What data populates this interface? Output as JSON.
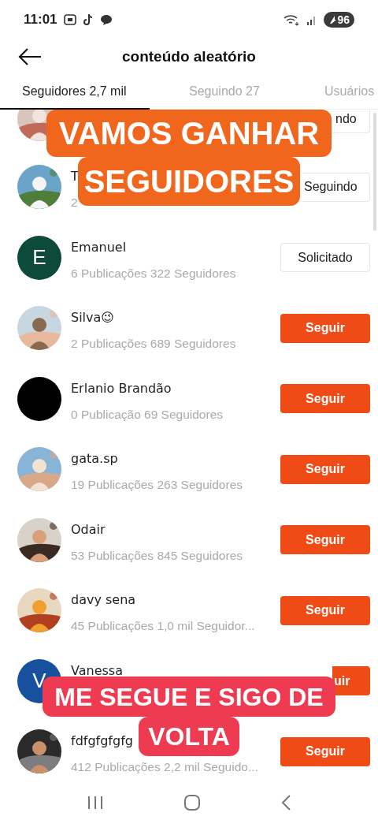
{
  "status_bar": {
    "time": "11:01",
    "battery": "96"
  },
  "header": {
    "title": "conteúdo aleatório"
  },
  "tabs": [
    {
      "label": "Seguidores 2,7 mil",
      "selected": true
    },
    {
      "label": "Seguindo 27",
      "selected": false
    },
    {
      "label": "Usuários",
      "selected": false
    }
  ],
  "rows": [
    {
      "button": {
        "kind": "outline-cut",
        "label": "ndo"
      }
    },
    {
      "name": "T",
      "stats": "2",
      "button": {
        "kind": "outline-part",
        "label": "Seguindo"
      }
    },
    {
      "avatar": {
        "kind": "letter",
        "letter": "E",
        "color": "#0e4a3a"
      },
      "name": "Emanuel",
      "stats": "6 Publicações 322 Seguidores",
      "button": {
        "kind": "outline",
        "label": "Solicitado"
      }
    },
    {
      "name": "Silva😉",
      "stats": "2 Publicações 689 Seguidores",
      "button": {
        "kind": "filled",
        "label": "Seguir"
      }
    },
    {
      "avatar": {
        "kind": "blank",
        "color": "#000000"
      },
      "name": "Erlanio Brandão",
      "stats": "0 Publicação 69 Seguidores",
      "button": {
        "kind": "filled",
        "label": "Seguir"
      }
    },
    {
      "name": "gata.sp",
      "stats": "19 Publicações 263 Seguidores",
      "button": {
        "kind": "filled",
        "label": "Seguir"
      }
    },
    {
      "name": "Odair",
      "stats": "53 Publicações 845 Seguidores",
      "button": {
        "kind": "filled",
        "label": "Seguir"
      }
    },
    {
      "name": "davy sena",
      "stats": "45 Publicações 1,0 mil Seguidor...",
      "button": {
        "kind": "filled",
        "label": "Seguir"
      }
    },
    {
      "avatar": {
        "kind": "letter",
        "letter": "V",
        "color": "#1850a0"
      },
      "name": "Vanessa",
      "button": {
        "kind": "filled-cut",
        "label": "uir"
      }
    },
    {
      "name": "fdfgfgfgfg",
      "stats": "412 Publicações 2,2 mil Seguido...",
      "button": {
        "kind": "filled",
        "label": "Seguir"
      }
    }
  ],
  "captions": [
    {
      "lines": [
        "VAMOS GANHAR",
        "SEGUIDORES"
      ],
      "color": "#f0661c"
    },
    {
      "lines": [
        "ME SEGUE E SIGO DE",
        "VOLTA"
      ],
      "color": "#ee3b52"
    }
  ]
}
